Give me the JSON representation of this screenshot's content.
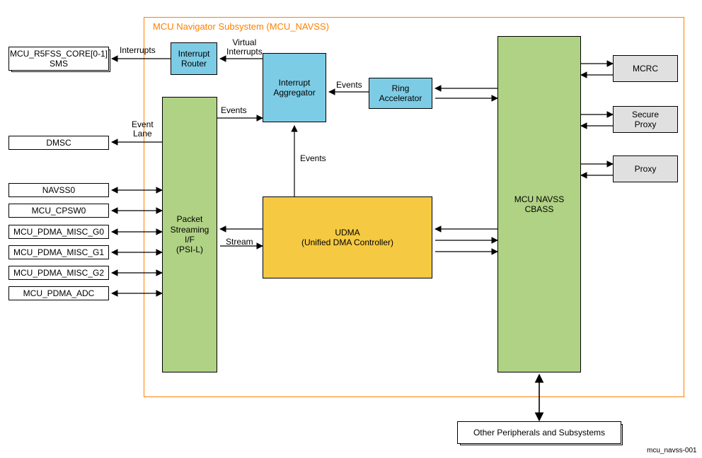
{
  "title": "MCU Navigator Subsystem (MCU_NAVSS)",
  "figure_id": "mcu_navss-001",
  "left_blocks": {
    "r5fss": "MCU_R5FSS_CORE[0-1]\nSMS",
    "dmsc": "DMSC",
    "navss0": "NAVSS0",
    "cpsw": "MCU_CPSW0",
    "pdma_g0": "MCU_PDMA_MISC_G0",
    "pdma_g1": "MCU_PDMA_MISC_G1",
    "pdma_g2": "MCU_PDMA_MISC_G2",
    "pdma_adc": "MCU_PDMA_ADC"
  },
  "navss_blocks": {
    "interrupt_router": "Interrupt\nRouter",
    "interrupt_aggregator": "Interrupt\nAggregator",
    "ring_accelerator": "Ring\nAccelerator",
    "psil": "Packet\nStreaming\nI/F\n(PSI-L)",
    "udma_line1": "UDMA",
    "udma_line2": "(Unified DMA Controller)",
    "cbass": "MCU NAVSS\nCBASS"
  },
  "right_blocks": {
    "mcrc": "MCRC",
    "secure_proxy": "Secure\nProxy",
    "proxy": "Proxy"
  },
  "bottom_block": "Other Peripherals and Subsystems",
  "edge_labels": {
    "interrupts": "Interrupts",
    "virtual_interrupts": "Virtual\nInterrupts",
    "events1": "Events",
    "events2": "Events",
    "events3": "Events",
    "event_lane": "Event\nLane",
    "stream": "Stream"
  }
}
